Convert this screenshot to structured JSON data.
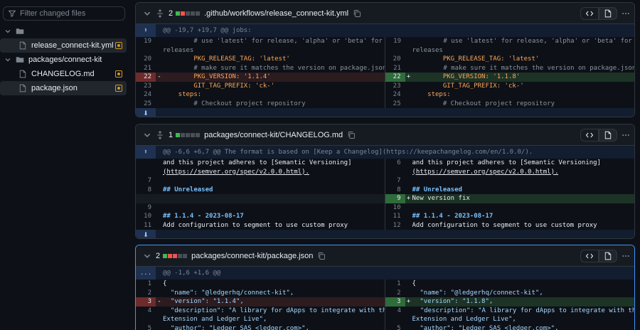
{
  "sidebar": {
    "filter_placeholder": "Filter changed files",
    "tree": [
      {
        "type": "folder",
        "label": "",
        "expanded": true
      },
      {
        "type": "file",
        "label": "release_connect-kit.yml",
        "selected": true
      },
      {
        "type": "folder",
        "label": "packages/connect-kit",
        "expanded": true
      },
      {
        "type": "file",
        "label": "CHANGELOG.md",
        "selected": false
      },
      {
        "type": "file",
        "label": "package.json",
        "selected": false
      }
    ]
  },
  "files": [
    {
      "changes": "2",
      "name": ".github/workflows/release_connect-kit.yml",
      "hunk": "@@ -19,7 +19,7 @@ jobs:",
      "rows": [
        {
          "l": {
            "n": "19",
            "t": "        # use 'latest' for release, 'alpha' or 'beta' for pre-"
          },
          "r": {
            "n": "19",
            "t": "        # use 'latest' for release, 'alpha' or 'beta' for pre-"
          }
        },
        {
          "l": {
            "n": "",
            "t": "releases"
          },
          "r": {
            "n": "",
            "t": "releases"
          }
        },
        {
          "l": {
            "n": "20",
            "t": "        PKG_RELEASE_TAG: 'latest'"
          },
          "r": {
            "n": "20",
            "t": "        PKG_RELEASE_TAG: 'latest'"
          }
        },
        {
          "l": {
            "n": "21",
            "t": "        # make sure it matches the version on package.json"
          },
          "r": {
            "n": "21",
            "t": "        # make sure it matches the version on package.json"
          }
        },
        {
          "l": {
            "n": "22",
            "m": "-",
            "t": "        PKG_VERSION: '1.1.4'"
          },
          "r": {
            "n": "22",
            "m": "+",
            "t": "        PKG_VERSION: '1.1.8'"
          }
        },
        {
          "l": {
            "n": "23",
            "t": "        GIT_TAG_PREFIX: 'ck-'"
          },
          "r": {
            "n": "23",
            "t": "        GIT_TAG_PREFIX: 'ck-'"
          }
        },
        {
          "l": {
            "n": "24",
            "t": "    steps:"
          },
          "r": {
            "n": "24",
            "t": "    steps:"
          }
        },
        {
          "l": {
            "n": "25",
            "t": "        # Checkout project repository"
          },
          "r": {
            "n": "25",
            "t": "        # Checkout project repository"
          }
        }
      ]
    },
    {
      "changes": "1",
      "name": "packages/connect-kit/CHANGELOG.md",
      "hunk": "@@ -6,6 +6,7 @@ The format is based on [Keep a Changelog](https://keepachangelog.com/en/1.0.0/).",
      "rows": [
        {
          "l": {
            "n": "",
            "t": "and this project adheres to [Semantic Versioning]"
          },
          "r": {
            "n": "6",
            "t": "and this project adheres to [Semantic Versioning]"
          }
        },
        {
          "l": {
            "n": "",
            "t": "(https://semver.org/spec/v2.0.0.html)."
          },
          "r": {
            "n": "",
            "t": "(https://semver.org/spec/v2.0.0.html)."
          }
        },
        {
          "l": {
            "n": "7",
            "t": ""
          },
          "r": {
            "n": "7",
            "t": ""
          }
        },
        {
          "l": {
            "n": "8",
            "t": "## Unreleased"
          },
          "r": {
            "n": "8",
            "t": "## Unreleased"
          }
        },
        {
          "l": {
            "n": "",
            "t": ""
          },
          "r": {
            "n": "9",
            "m": "+",
            "t": "New version fix"
          }
        },
        {
          "l": {
            "n": "9",
            "t": ""
          },
          "r": {
            "n": "10",
            "t": ""
          }
        },
        {
          "l": {
            "n": "10",
            "t": "## 1.1.4 - 2023-08-17"
          },
          "r": {
            "n": "11",
            "t": "## 1.1.4 - 2023-08-17"
          }
        },
        {
          "l": {
            "n": "11",
            "t": "Add configuration to segment to use custom proxy"
          },
          "r": {
            "n": "12",
            "t": "Add configuration to segment to use custom proxy"
          }
        }
      ]
    },
    {
      "changes": "2",
      "name": "packages/connect-kit/package.json",
      "hunk": "@@ -1,6 +1,6 @@",
      "expander": "...",
      "rows": [
        {
          "l": {
            "n": "1",
            "t": "{"
          },
          "r": {
            "n": "1",
            "t": "{"
          }
        },
        {
          "l": {
            "n": "2",
            "t": "  \"name\": \"@ledgerhq/connect-kit\","
          },
          "r": {
            "n": "2",
            "t": "  \"name\": \"@ledgerhq/connect-kit\","
          }
        },
        {
          "l": {
            "n": "3",
            "m": "-",
            "t": "  \"version\": \"1.1.4\","
          },
          "r": {
            "n": "3",
            "m": "+",
            "t": "  \"version\": \"1.1.8\","
          }
        },
        {
          "l": {
            "n": "4",
            "t": "  \"description\": \"A library for dApps to integrate with the Ledger"
          },
          "r": {
            "n": "4",
            "t": "  \"description\": \"A library for dApps to integrate with the Ledger"
          }
        },
        {
          "l": {
            "n": "",
            "t": "Extension and Ledger Live\","
          },
          "r": {
            "n": "",
            "t": "Extension and Ledger Live\","
          }
        },
        {
          "l": {
            "n": "5",
            "t": "  \"author\": \"Ledger SAS <ledger.com>\","
          },
          "r": {
            "n": "5",
            "t": "  \"author\": \"Ledger SAS <ledger.com>\","
          }
        }
      ]
    }
  ],
  "colors": {
    "added": "#3fb950",
    "deleted": "#f85149",
    "modified": "#d29922",
    "accent": "#4493f8"
  }
}
